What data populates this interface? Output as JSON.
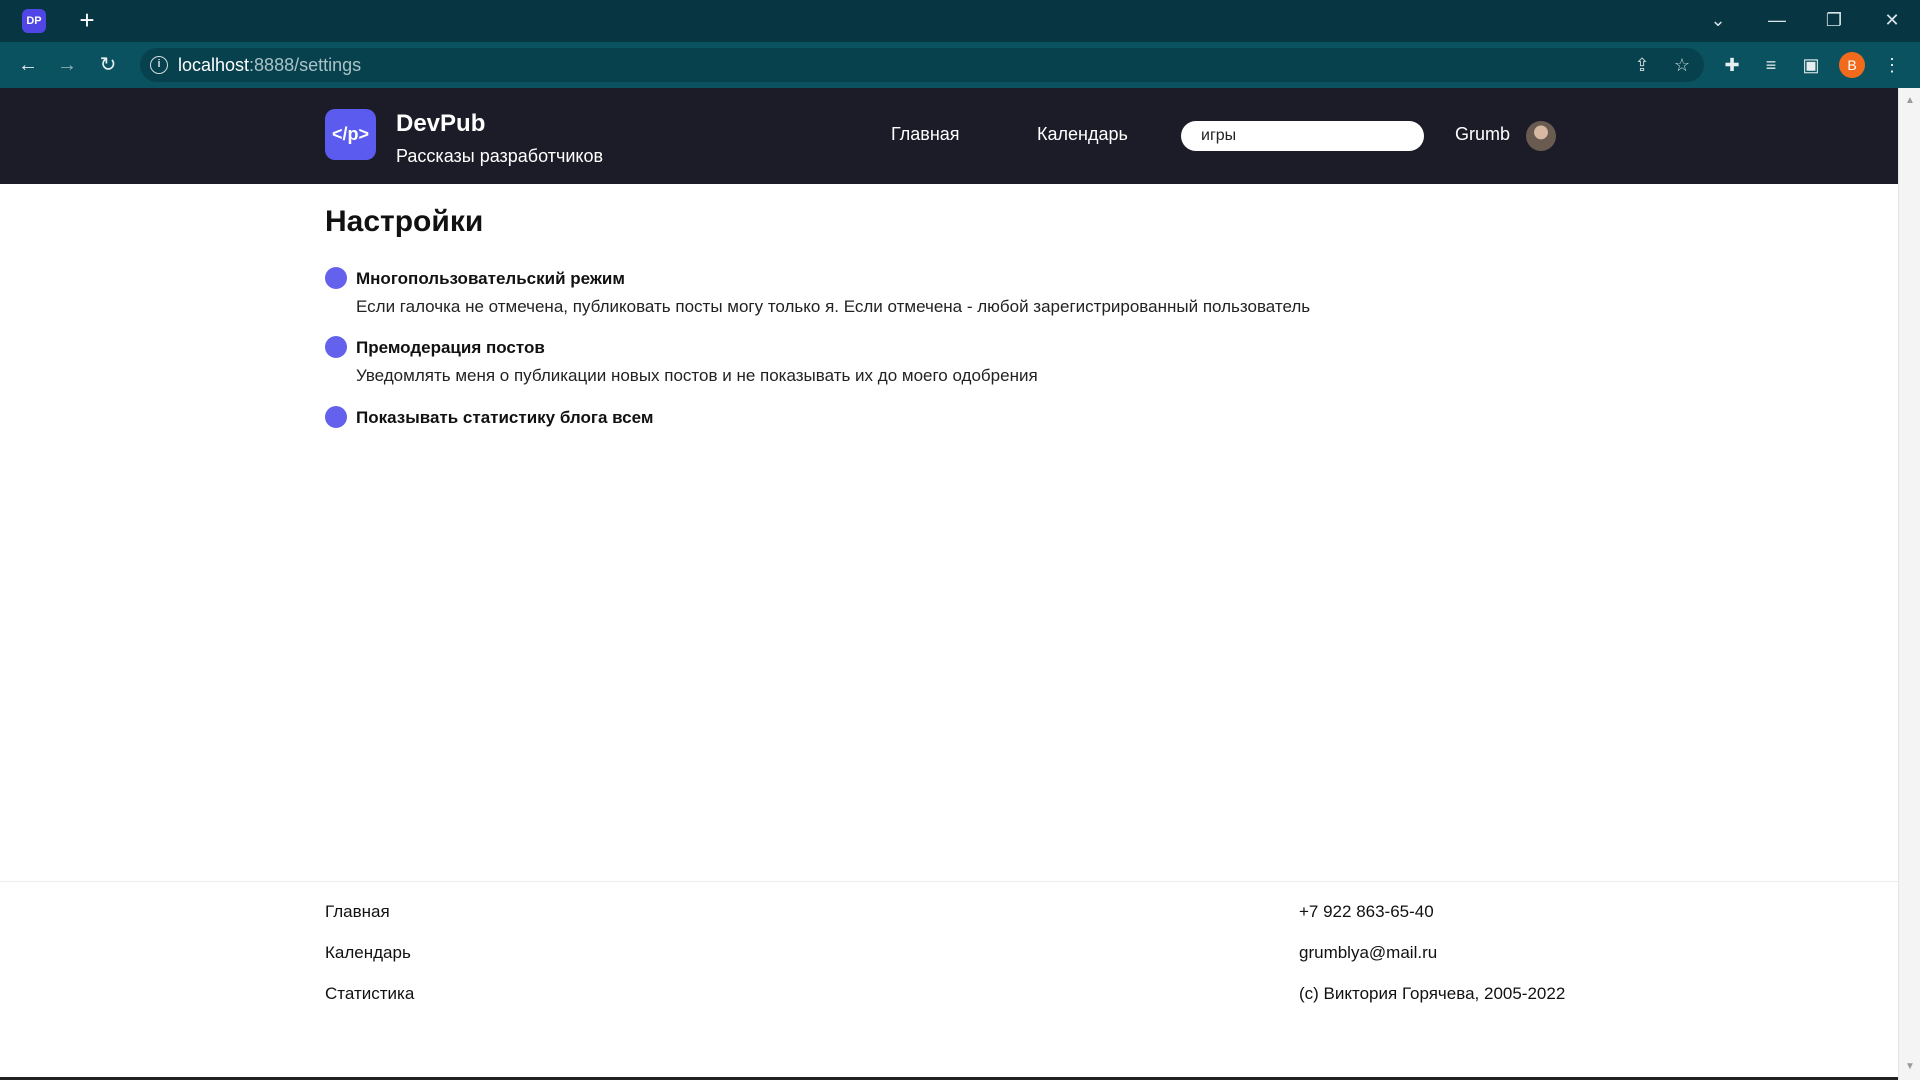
{
  "browser": {
    "tab_favicon_text": "DP",
    "new_tab": "+",
    "url_host": "localhost",
    "url_rest": ":8888/settings",
    "profile_initial": "B"
  },
  "header": {
    "logo_text": "</p>",
    "brand": "DevPub",
    "tagline": "Рассказы разработчиков",
    "nav": [
      "Главная",
      "Календарь"
    ],
    "search_value": "игры",
    "username": "Grumb"
  },
  "main": {
    "title": "Настройки",
    "settings": [
      {
        "title": "Многопользовательский режим",
        "description": "Если галочка не отмечена, публиковать посты могу только я. Если отмечена - любой зарегистрированный пользователь"
      },
      {
        "title": "Премодерация постов",
        "description": "Уведомлять меня о публикации новых постов и не показывать их до моего одобрения"
      },
      {
        "title": "Показывать статистику блога всем",
        "description": ""
      }
    ]
  },
  "footer": {
    "links": [
      "Главная",
      "Календарь",
      "Статистика"
    ],
    "phone": "+7 922 863-65-40",
    "email": "grumblya@mail.ru",
    "copyright": "(c) Виктория Горячева, 2005-2022"
  },
  "colors": {
    "header_bg": "#1c1b28",
    "accent": "#6461ec",
    "browser_frame": "#073642"
  }
}
